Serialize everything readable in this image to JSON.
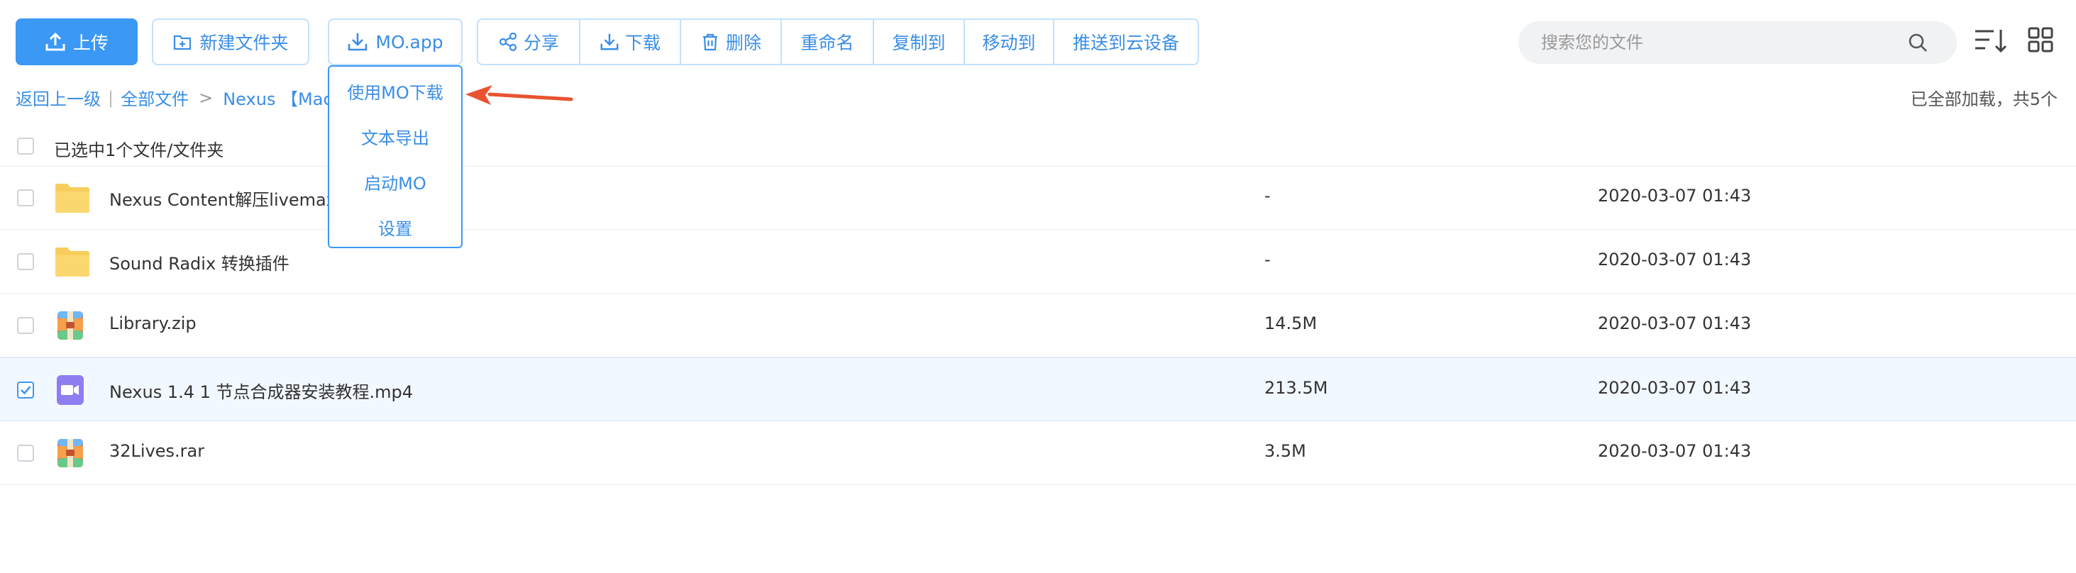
{
  "toolbar": {
    "upload": "上传",
    "new_folder": "新建文件夹",
    "mo_app": "MO.app",
    "share": "分享",
    "download": "下载",
    "delete": "删除",
    "rename": "重命名",
    "copy_to": "复制到",
    "move_to": "移动到",
    "push_device": "推送到云设备"
  },
  "dropdown": {
    "items": [
      "使用MO下载",
      "文本导出",
      "启动MO",
      "设置"
    ]
  },
  "search": {
    "placeholder": "搜索您的文件"
  },
  "breadcrumb": {
    "back": "返回上一级",
    "all_files": "全部文件",
    "current": "Nexus 【Mac版】"
  },
  "loaded_status": "已全部加载，共5个",
  "selection_text": "已选中1个文件/文件夹",
  "files": [
    {
      "name": "Nexus Content解压livemax12",
      "size": "-",
      "date": "2020-03-07 01:43",
      "type": "folder-icon",
      "checked": false
    },
    {
      "name": "Sound Radix 转换插件",
      "size": "-",
      "date": "2020-03-07 01:43",
      "type": "folder-icon",
      "checked": false
    },
    {
      "name": "Library.zip",
      "size": "14.5M",
      "date": "2020-03-07 01:43",
      "type": "archive-icon",
      "checked": false
    },
    {
      "name": "Nexus 1.4 1 节点合成器安装教程.mp4",
      "size": "213.5M",
      "date": "2020-03-07 01:43",
      "type": "video-icon",
      "checked": true
    },
    {
      "name": "32Lives.rar",
      "size": "3.5M",
      "date": "2020-03-07 01:43",
      "type": "archive-icon",
      "checked": false
    }
  ],
  "colors": {
    "accent": "#3b98f5",
    "link": "#3a8ee6",
    "border": "#c3e1fb",
    "annotation_arrow": "#e8532f",
    "selected_row": "#f2f8ff"
  }
}
